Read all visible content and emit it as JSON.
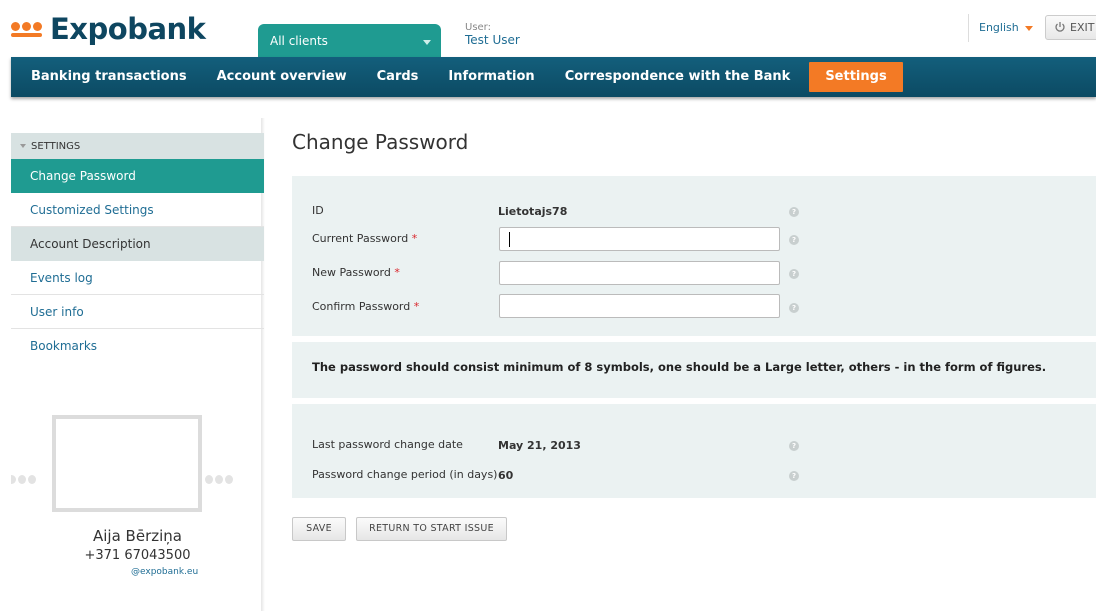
{
  "brand": {
    "name": "Expobank",
    "accent": "#f37a25",
    "primary": "#0e4660",
    "teal": "#1f9b91"
  },
  "header": {
    "client_selector": "All clients",
    "user_label": "User:",
    "user_name": "Test User",
    "language": "English",
    "exit_label": "EXIT"
  },
  "nav": {
    "items": [
      {
        "label": "Banking transactions"
      },
      {
        "label": "Account overview"
      },
      {
        "label": "Cards"
      },
      {
        "label": "Information"
      },
      {
        "label": "Correspondence with the Bank"
      },
      {
        "label": "Settings",
        "active": true
      }
    ]
  },
  "sidebar": {
    "header": "SETTINGS",
    "items": [
      {
        "label": "Change Password",
        "active": true
      },
      {
        "label": "Customized Settings"
      },
      {
        "label": "Account Description"
      },
      {
        "label": "Events log"
      },
      {
        "label": "User info"
      },
      {
        "label": "Bookmarks"
      }
    ],
    "contact": {
      "name": "Aija Bērziņa",
      "phone": "+371 67043500",
      "email": "@expobank.eu"
    }
  },
  "main": {
    "title": "Change Password",
    "form": {
      "id_label": "ID",
      "id_value": "Lietotajs78",
      "current_label": "Current Password",
      "new_label": "New Password",
      "confirm_label": "Confirm Password",
      "required_mark": "*",
      "current_value": "",
      "new_value": "",
      "confirm_value": ""
    },
    "notice": "The password should consist minimum of 8 symbols, one should be a Large letter, others - in the form of figures.",
    "info": {
      "last_change_label": "Last password change date",
      "last_change_value": "May 21, 2013",
      "period_label": "Password change period (in days)",
      "period_value": "60"
    },
    "buttons": {
      "save": "SAVE",
      "return": "RETURN TO START ISSUE"
    }
  },
  "icons": {
    "help": "question-icon",
    "power": "power-icon",
    "dropdown": "chevron-down-icon"
  }
}
